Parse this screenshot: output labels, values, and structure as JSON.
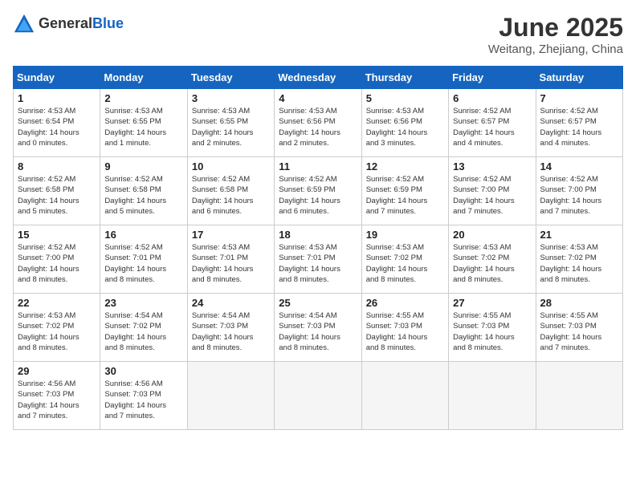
{
  "logo": {
    "general": "General",
    "blue": "Blue"
  },
  "header": {
    "month": "June 2025",
    "location": "Weitang, Zhejiang, China"
  },
  "weekdays": [
    "Sunday",
    "Monday",
    "Tuesday",
    "Wednesday",
    "Thursday",
    "Friday",
    "Saturday"
  ],
  "weeks": [
    [
      {
        "day": "1",
        "info": "Sunrise: 4:53 AM\nSunset: 6:54 PM\nDaylight: 14 hours\nand 0 minutes."
      },
      {
        "day": "2",
        "info": "Sunrise: 4:53 AM\nSunset: 6:55 PM\nDaylight: 14 hours\nand 1 minute."
      },
      {
        "day": "3",
        "info": "Sunrise: 4:53 AM\nSunset: 6:55 PM\nDaylight: 14 hours\nand 2 minutes."
      },
      {
        "day": "4",
        "info": "Sunrise: 4:53 AM\nSunset: 6:56 PM\nDaylight: 14 hours\nand 2 minutes."
      },
      {
        "day": "5",
        "info": "Sunrise: 4:53 AM\nSunset: 6:56 PM\nDaylight: 14 hours\nand 3 minutes."
      },
      {
        "day": "6",
        "info": "Sunrise: 4:52 AM\nSunset: 6:57 PM\nDaylight: 14 hours\nand 4 minutes."
      },
      {
        "day": "7",
        "info": "Sunrise: 4:52 AM\nSunset: 6:57 PM\nDaylight: 14 hours\nand 4 minutes."
      }
    ],
    [
      {
        "day": "8",
        "info": "Sunrise: 4:52 AM\nSunset: 6:58 PM\nDaylight: 14 hours\nand 5 minutes."
      },
      {
        "day": "9",
        "info": "Sunrise: 4:52 AM\nSunset: 6:58 PM\nDaylight: 14 hours\nand 5 minutes."
      },
      {
        "day": "10",
        "info": "Sunrise: 4:52 AM\nSunset: 6:58 PM\nDaylight: 14 hours\nand 6 minutes."
      },
      {
        "day": "11",
        "info": "Sunrise: 4:52 AM\nSunset: 6:59 PM\nDaylight: 14 hours\nand 6 minutes."
      },
      {
        "day": "12",
        "info": "Sunrise: 4:52 AM\nSunset: 6:59 PM\nDaylight: 14 hours\nand 7 minutes."
      },
      {
        "day": "13",
        "info": "Sunrise: 4:52 AM\nSunset: 7:00 PM\nDaylight: 14 hours\nand 7 minutes."
      },
      {
        "day": "14",
        "info": "Sunrise: 4:52 AM\nSunset: 7:00 PM\nDaylight: 14 hours\nand 7 minutes."
      }
    ],
    [
      {
        "day": "15",
        "info": "Sunrise: 4:52 AM\nSunset: 7:00 PM\nDaylight: 14 hours\nand 8 minutes."
      },
      {
        "day": "16",
        "info": "Sunrise: 4:52 AM\nSunset: 7:01 PM\nDaylight: 14 hours\nand 8 minutes."
      },
      {
        "day": "17",
        "info": "Sunrise: 4:53 AM\nSunset: 7:01 PM\nDaylight: 14 hours\nand 8 minutes."
      },
      {
        "day": "18",
        "info": "Sunrise: 4:53 AM\nSunset: 7:01 PM\nDaylight: 14 hours\nand 8 minutes."
      },
      {
        "day": "19",
        "info": "Sunrise: 4:53 AM\nSunset: 7:02 PM\nDaylight: 14 hours\nand 8 minutes."
      },
      {
        "day": "20",
        "info": "Sunrise: 4:53 AM\nSunset: 7:02 PM\nDaylight: 14 hours\nand 8 minutes."
      },
      {
        "day": "21",
        "info": "Sunrise: 4:53 AM\nSunset: 7:02 PM\nDaylight: 14 hours\nand 8 minutes."
      }
    ],
    [
      {
        "day": "22",
        "info": "Sunrise: 4:53 AM\nSunset: 7:02 PM\nDaylight: 14 hours\nand 8 minutes."
      },
      {
        "day": "23",
        "info": "Sunrise: 4:54 AM\nSunset: 7:02 PM\nDaylight: 14 hours\nand 8 minutes."
      },
      {
        "day": "24",
        "info": "Sunrise: 4:54 AM\nSunset: 7:03 PM\nDaylight: 14 hours\nand 8 minutes."
      },
      {
        "day": "25",
        "info": "Sunrise: 4:54 AM\nSunset: 7:03 PM\nDaylight: 14 hours\nand 8 minutes."
      },
      {
        "day": "26",
        "info": "Sunrise: 4:55 AM\nSunset: 7:03 PM\nDaylight: 14 hours\nand 8 minutes."
      },
      {
        "day": "27",
        "info": "Sunrise: 4:55 AM\nSunset: 7:03 PM\nDaylight: 14 hours\nand 8 minutes."
      },
      {
        "day": "28",
        "info": "Sunrise: 4:55 AM\nSunset: 7:03 PM\nDaylight: 14 hours\nand 7 minutes."
      }
    ],
    [
      {
        "day": "29",
        "info": "Sunrise: 4:56 AM\nSunset: 7:03 PM\nDaylight: 14 hours\nand 7 minutes."
      },
      {
        "day": "30",
        "info": "Sunrise: 4:56 AM\nSunset: 7:03 PM\nDaylight: 14 hours\nand 7 minutes."
      },
      {
        "day": "",
        "info": ""
      },
      {
        "day": "",
        "info": ""
      },
      {
        "day": "",
        "info": ""
      },
      {
        "day": "",
        "info": ""
      },
      {
        "day": "",
        "info": ""
      }
    ]
  ]
}
